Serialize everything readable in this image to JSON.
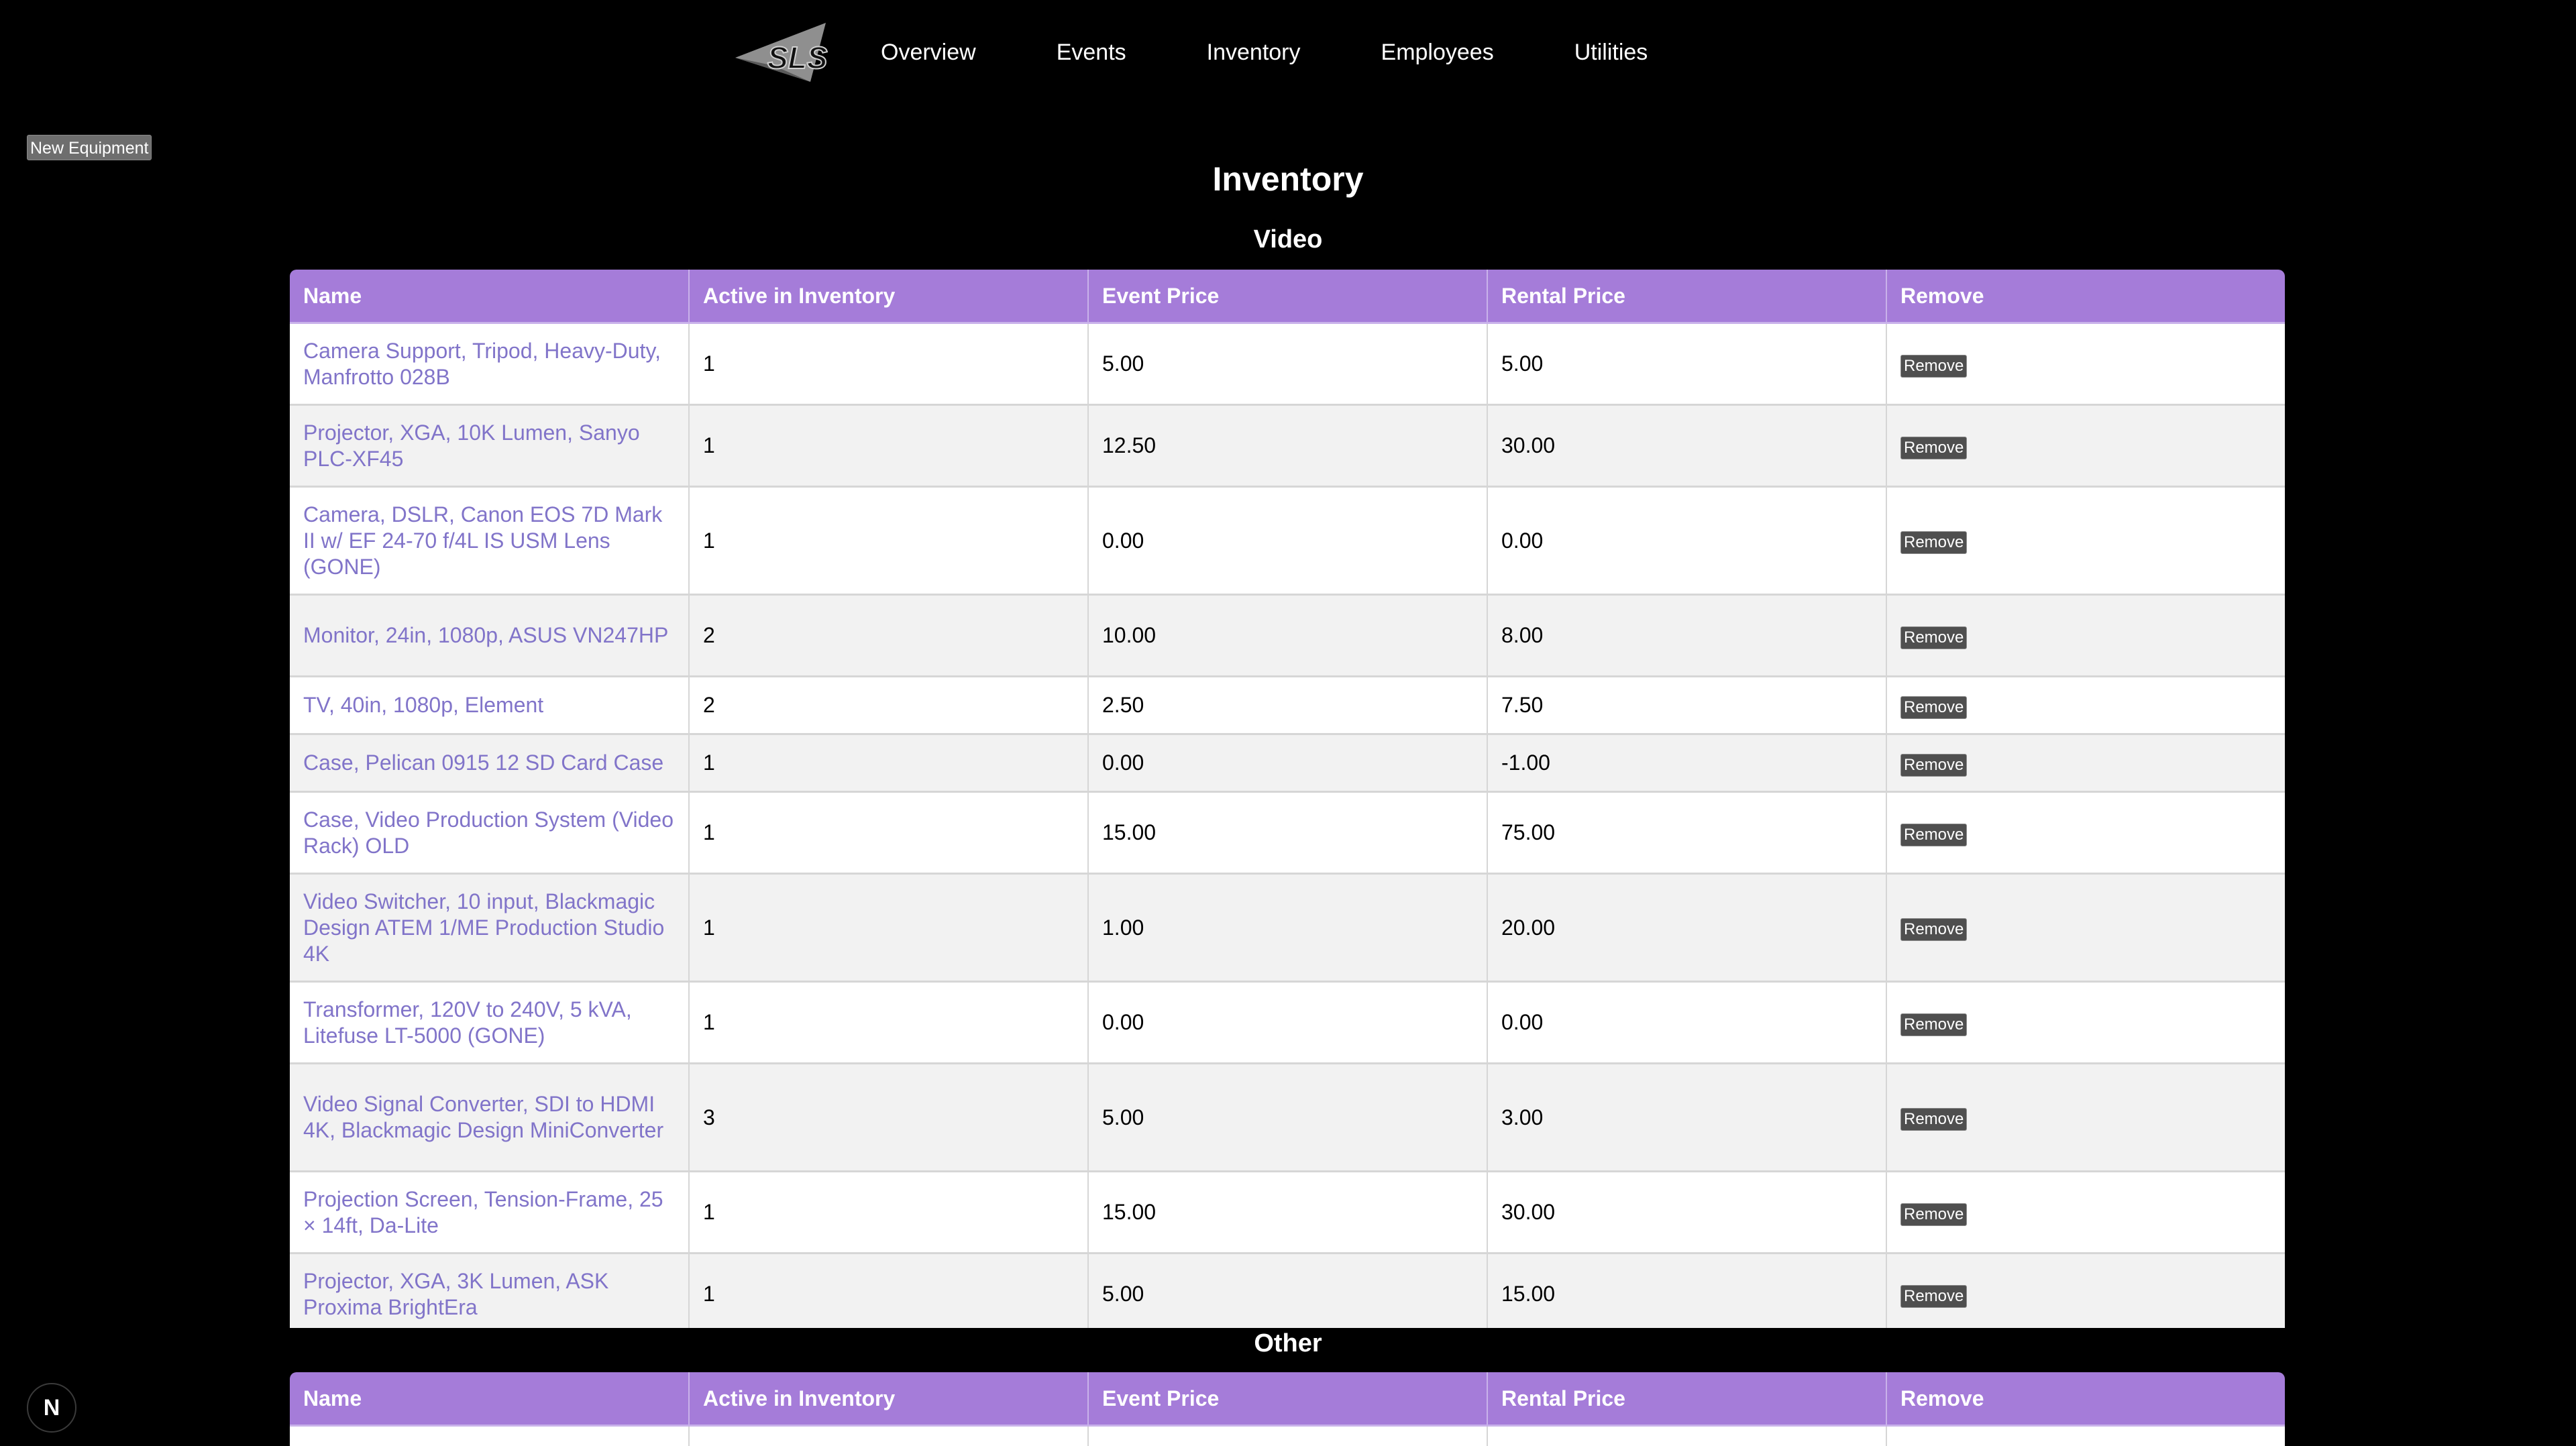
{
  "logo": {
    "text": "SLS",
    "icon": "sls-logo"
  },
  "nav": [
    {
      "label": "Overview"
    },
    {
      "label": "Events"
    },
    {
      "label": "Inventory"
    },
    {
      "label": "Employees"
    },
    {
      "label": "Utilities"
    }
  ],
  "actions": {
    "new_equipment": "New Equipment"
  },
  "page_title": "Inventory",
  "columns": [
    "Name",
    "Active in Inventory",
    "Event Price",
    "Rental Price",
    "Remove"
  ],
  "sections": [
    {
      "title": "Video",
      "rows": [
        {
          "name": "Camera Support, Tripod, Heavy-Duty, Manfrotto 028B",
          "active": "1",
          "event_price": "5.00",
          "rental_price": "5.00",
          "remove": "Remove"
        },
        {
          "name": "Projector, XGA, 10K Lumen, Sanyo PLC-XF45",
          "active": "1",
          "event_price": "12.50",
          "rental_price": "30.00",
          "remove": "Remove"
        },
        {
          "name": "Camera, DSLR, Canon EOS 7D Mark II w/ EF 24-70 f/4L IS USM Lens (GONE)",
          "active": "1",
          "event_price": "0.00",
          "rental_price": "0.00",
          "remove": "Remove"
        },
        {
          "name": "Monitor, 24in, 1080p, ASUS VN247HP",
          "active": "2",
          "event_price": "10.00",
          "rental_price": "8.00",
          "remove": "Remove"
        },
        {
          "name": "TV, 40in, 1080p, Element",
          "active": "2",
          "event_price": "2.50",
          "rental_price": "7.50",
          "remove": "Remove"
        },
        {
          "name": "Case, Pelican 0915 12 SD Card Case",
          "active": "1",
          "event_price": "0.00",
          "rental_price": "-1.00",
          "remove": "Remove"
        },
        {
          "name": "Case, Video Production System (Video Rack) OLD",
          "active": "1",
          "event_price": "15.00",
          "rental_price": "75.00",
          "remove": "Remove"
        },
        {
          "name": "Video Switcher, 10 input, Blackmagic Design ATEM 1/ME Production Studio 4K",
          "active": "1",
          "event_price": "1.00",
          "rental_price": "20.00",
          "remove": "Remove"
        },
        {
          "name": "Transformer, 120V to 240V, 5 kVA, Litefuse LT-5000 (GONE)",
          "active": "1",
          "event_price": "0.00",
          "rental_price": "0.00",
          "remove": "Remove"
        },
        {
          "name": "Video Signal Converter, SDI to HDMI 4K, Blackmagic Design MiniConverter",
          "active": "3",
          "event_price": "5.00",
          "rental_price": "3.00",
          "remove": "Remove"
        },
        {
          "name": "Projection Screen, Tension-Frame, 25 × 14ft, Da-Lite",
          "active": "1",
          "event_price": "15.00",
          "rental_price": "30.00",
          "remove": "Remove"
        },
        {
          "name": "Projector, XGA, 3K Lumen, ASK Proxima BrightEra",
          "active": "1",
          "event_price": "5.00",
          "rental_price": "15.00",
          "remove": "Remove"
        }
      ]
    },
    {
      "title": "Other",
      "rows": []
    }
  ],
  "badge": {
    "label": "N",
    "icon": "nextjs-icon"
  }
}
